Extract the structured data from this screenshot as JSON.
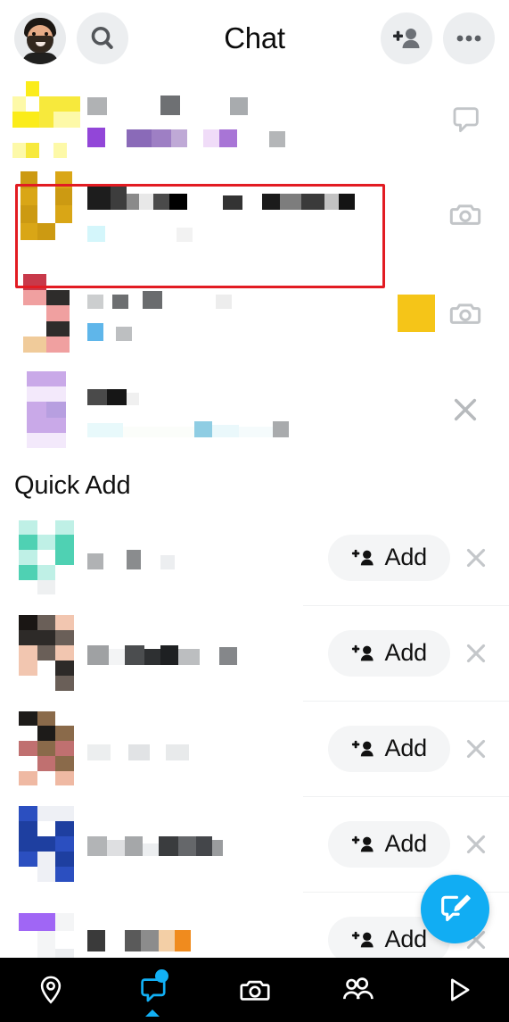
{
  "header": {
    "title": "Chat",
    "avatar_icon": "bitmoji-avatar",
    "search_icon": "search-icon",
    "add_friend_icon": "add-friend-icon",
    "more_icon": "more-options-icon"
  },
  "chat_list": {
    "rows": [
      {
        "id": "chat-row-1",
        "name_redacted": true,
        "status_redacted": true,
        "action_icon": "chat-bubble-icon",
        "avatar_palette": [
          "#fbec1a",
          "#f7e93c",
          "#fdf9a8",
          "#ffffff"
        ],
        "name_blocks": [
          {
            "w": 22,
            "h": 20,
            "c": "#b0b2b4"
          },
          {
            "w": 60,
            "h": 20,
            "c": "#ffffff"
          },
          {
            "w": 22,
            "h": 22,
            "c": "#6e7073"
          },
          {
            "w": 56,
            "h": 16,
            "c": "#ffffff"
          },
          {
            "w": 20,
            "h": 20,
            "c": "#a8abae"
          }
        ],
        "preview_blocks": [
          {
            "w": 20,
            "h": 22,
            "c": "#9246d8"
          },
          {
            "w": 24,
            "h": 14,
            "c": "#ffffff"
          },
          {
            "w": 28,
            "h": 20,
            "c": "#8a6ab8"
          },
          {
            "w": 22,
            "h": 20,
            "c": "#9e7fc4"
          },
          {
            "w": 18,
            "h": 20,
            "c": "#bfa9d6"
          },
          {
            "w": 18,
            "h": 14,
            "c": "#ffffff"
          },
          {
            "w": 18,
            "h": 20,
            "c": "#f0dcf8"
          },
          {
            "w": 20,
            "h": 20,
            "c": "#a875d6"
          },
          {
            "w": 36,
            "h": 14,
            "c": "#ffffff"
          },
          {
            "w": 18,
            "h": 18,
            "c": "#b4b6b8"
          }
        ]
      },
      {
        "id": "chat-row-2",
        "highlighted": true,
        "name_redacted": true,
        "status_redacted": true,
        "action_icon": "camera-icon",
        "avatar_palette": [
          "#cc9a12",
          "#d9a616",
          "#ffffff"
        ],
        "name_blocks": [
          {
            "w": 26,
            "h": 26,
            "c": "#1d1d1d"
          },
          {
            "w": 18,
            "h": 26,
            "c": "#3d3d3d"
          },
          {
            "w": 14,
            "h": 18,
            "c": "#8a8a8a"
          },
          {
            "w": 16,
            "h": 18,
            "c": "#e8e8e8"
          },
          {
            "w": 18,
            "h": 18,
            "c": "#4a4a4a"
          },
          {
            "w": 20,
            "h": 18,
            "c": "#000000"
          },
          {
            "w": 40,
            "h": 10,
            "c": "#ffffff"
          },
          {
            "w": 22,
            "h": 16,
            "c": "#333333"
          },
          {
            "w": 22,
            "h": 10,
            "c": "#ffffff"
          },
          {
            "w": 20,
            "h": 18,
            "c": "#1b1b1b"
          },
          {
            "w": 24,
            "h": 18,
            "c": "#7d7d7d"
          },
          {
            "w": 26,
            "h": 18,
            "c": "#3a3a3a"
          },
          {
            "w": 16,
            "h": 18,
            "c": "#c2c2c2"
          },
          {
            "w": 18,
            "h": 18,
            "c": "#141414"
          }
        ],
        "preview_blocks": [
          {
            "w": 20,
            "h": 18,
            "c": "#d4f6fb"
          },
          {
            "w": 80,
            "h": 10,
            "c": "#ffffff"
          },
          {
            "w": 18,
            "h": 16,
            "c": "#f2f2f2"
          }
        ]
      },
      {
        "id": "chat-row-3",
        "name_redacted": true,
        "status_redacted": true,
        "action_icon": "camera-icon",
        "has_snap_thumb": true,
        "snap_thumb_color": "#f5c518",
        "avatar_palette": [
          "#2e2c2b",
          "#f0cb9a",
          "#5b5b58",
          "#f0a0a0",
          "#c8394a"
        ],
        "name_blocks": [
          {
            "w": 18,
            "h": 16,
            "c": "#cccecf"
          },
          {
            "w": 10,
            "h": 14,
            "c": "#ffffff"
          },
          {
            "w": 18,
            "h": 16,
            "c": "#6d6f71"
          },
          {
            "w": 16,
            "h": 14,
            "c": "#ffffff"
          },
          {
            "w": 22,
            "h": 20,
            "c": "#6a6c6e"
          },
          {
            "w": 60,
            "h": 12,
            "c": "#ffffff"
          },
          {
            "w": 18,
            "h": 16,
            "c": "#ededed"
          }
        ],
        "preview_blocks": [
          {
            "w": 18,
            "h": 20,
            "c": "#5fb6ea"
          },
          {
            "w": 14,
            "h": 14,
            "c": "#ffffff"
          },
          {
            "w": 18,
            "h": 16,
            "c": "#bdbfc1"
          }
        ]
      },
      {
        "id": "chat-row-4",
        "name_redacted": true,
        "status_redacted": true,
        "action_icon": "close-x-icon",
        "avatar_palette": [
          "#f3e9fb",
          "#c9a9e8",
          "#b79fe0",
          "#c5a7ef"
        ],
        "name_blocks": [
          {
            "w": 22,
            "h": 18,
            "c": "#4a4a4a"
          },
          {
            "w": 22,
            "h": 18,
            "c": "#161616"
          },
          {
            "w": 14,
            "h": 14,
            "c": "#f0f0f0"
          }
        ],
        "preview_blocks": [
          {
            "w": 40,
            "h": 16,
            "c": "#e8f9fb"
          },
          {
            "w": 80,
            "h": 12,
            "c": "#fbfdfa"
          },
          {
            "w": 20,
            "h": 18,
            "c": "#8fcde3"
          },
          {
            "w": 30,
            "h": 14,
            "c": "#eaf8fb"
          },
          {
            "w": 38,
            "h": 12,
            "c": "#f5fbfc"
          },
          {
            "w": 18,
            "h": 18,
            "c": "#a9abad"
          }
        ]
      }
    ]
  },
  "quick_add": {
    "title": "Quick Add",
    "add_label": "Add",
    "add_icon": "add-person-icon",
    "dismiss_icon": "close-x-icon",
    "rows": [
      {
        "id": "quick-add-row-1",
        "name_redacted": true,
        "avatar_palette": [
          "#4fd1b3",
          "#bff0e6",
          "#eef0f1"
        ],
        "name_blocks": [
          {
            "w": 18,
            "h": 18,
            "c": "#b0b2b4"
          },
          {
            "w": 26,
            "h": 10,
            "c": "#ffffff"
          },
          {
            "w": 16,
            "h": 22,
            "c": "#8a8c8e"
          },
          {
            "w": 22,
            "h": 10,
            "c": "#ffffff"
          },
          {
            "w": 16,
            "h": 16,
            "c": "#eceef0"
          }
        ]
      },
      {
        "id": "quick-add-row-2",
        "name_redacted": true,
        "avatar_palette": [
          "#2d2a28",
          "#f2c6b0",
          "#1a1614",
          "#6a5f58"
        ],
        "name_blocks": [
          {
            "w": 24,
            "h": 22,
            "c": "#9fa1a3"
          },
          {
            "w": 18,
            "h": 18,
            "c": "#f3f4f5"
          },
          {
            "w": 22,
            "h": 22,
            "c": "#4b4d4f"
          },
          {
            "w": 18,
            "h": 18,
            "c": "#2e3032"
          },
          {
            "w": 20,
            "h": 22,
            "c": "#1e2022"
          },
          {
            "w": 24,
            "h": 18,
            "c": "#bcbec0"
          },
          {
            "w": 22,
            "h": 10,
            "c": "#ffffff"
          },
          {
            "w": 20,
            "h": 20,
            "c": "#85878a"
          }
        ]
      },
      {
        "id": "quick-add-row-3",
        "name_redacted": true,
        "avatar_palette": [
          "#c07070",
          "#1d1b19",
          "#efb9a3",
          "#8a6a4a"
        ],
        "name_blocks": [
          {
            "w": 26,
            "h": 18,
            "c": "#eceeef"
          },
          {
            "w": 20,
            "h": 10,
            "c": "#ffffff"
          },
          {
            "w": 24,
            "h": 18,
            "c": "#e1e3e5"
          },
          {
            "w": 18,
            "h": 10,
            "c": "#ffffff"
          },
          {
            "w": 26,
            "h": 18,
            "c": "#e8eaeb"
          }
        ]
      },
      {
        "id": "quick-add-row-4",
        "name_redacted": true,
        "avatar_palette": [
          "#1e3fa0",
          "#eef0f5",
          "#2b4fc0"
        ],
        "name_blocks": [
          {
            "w": 22,
            "h": 22,
            "c": "#b2b4b6"
          },
          {
            "w": 20,
            "h": 18,
            "c": "#dedfe1"
          },
          {
            "w": 20,
            "h": 22,
            "c": "#a5a7a9"
          },
          {
            "w": 18,
            "h": 14,
            "c": "#eceef0"
          },
          {
            "w": 22,
            "h": 22,
            "c": "#3a3c3e"
          },
          {
            "w": 20,
            "h": 22,
            "c": "#65676a"
          },
          {
            "w": 18,
            "h": 22,
            "c": "#44464a"
          },
          {
            "w": 12,
            "h": 18,
            "c": "#9a9c9e"
          }
        ]
      },
      {
        "id": "quick-add-row-5",
        "name_redacted": true,
        "partially_visible": true,
        "avatar_palette": [
          "#a066f5",
          "#eceef0",
          "#f4f5f6"
        ],
        "name_blocks": [
          {
            "w": 20,
            "h": 24,
            "c": "#3a3a3a"
          },
          {
            "w": 22,
            "h": 12,
            "c": "#ffffff"
          },
          {
            "w": 18,
            "h": 24,
            "c": "#5a5a5a"
          },
          {
            "w": 20,
            "h": 24,
            "c": "#8c8c8c"
          },
          {
            "w": 18,
            "h": 24,
            "c": "#f3cfa6"
          },
          {
            "w": 18,
            "h": 24,
            "c": "#f08b1e"
          }
        ]
      }
    ]
  },
  "fab": {
    "icon": "compose-chat-icon",
    "color": "#11adf3"
  },
  "bottom_nav": {
    "items": [
      {
        "id": "nav-map",
        "icon": "map-pin-icon",
        "active": false
      },
      {
        "id": "nav-chat",
        "icon": "chat-icon",
        "active": true,
        "badge": true
      },
      {
        "id": "nav-camera",
        "icon": "camera-icon",
        "active": false
      },
      {
        "id": "nav-friends",
        "icon": "friends-icon",
        "active": false
      },
      {
        "id": "nav-stories",
        "icon": "play-icon",
        "active": false
      }
    ],
    "active_color": "#12b0f5",
    "inactive_color": "#ffffff",
    "background": "#000000"
  },
  "annotation": {
    "type": "red-highlight-box",
    "color": "#e21b22",
    "target": "chat-row-2"
  }
}
